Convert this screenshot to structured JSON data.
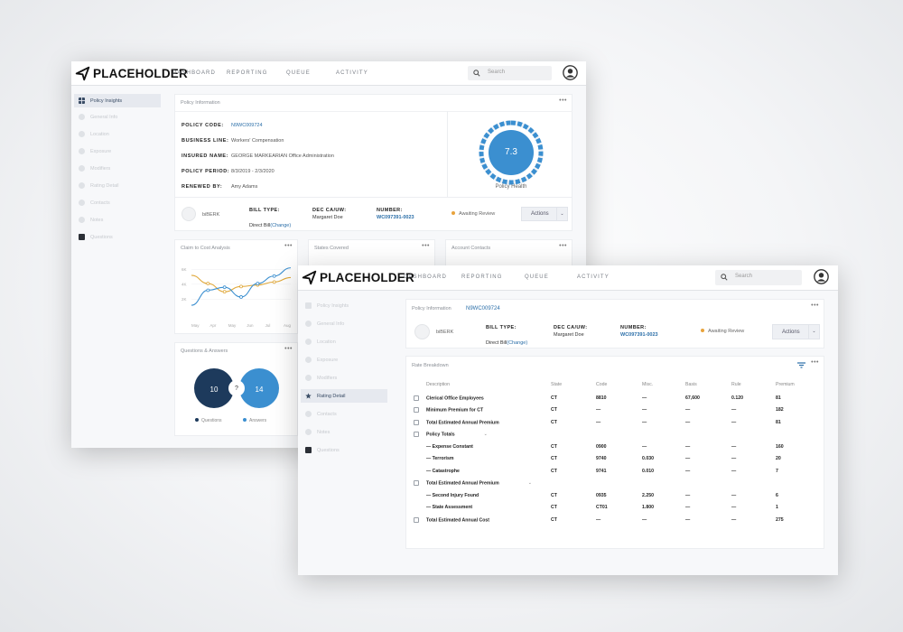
{
  "colors": {
    "accent": "#2a6ea8",
    "gauge": "#3b8fd0",
    "warning": "#e8a33c",
    "navy": "#1d3a5c",
    "line_blue": "#3b8fd0",
    "line_orange": "#e0a83a"
  },
  "back_window": {
    "logo": "PLACEHOLDER",
    "nav": [
      "DASHBOARD",
      "REPORTING",
      "QUEUE",
      "ACTIVITY"
    ],
    "search_placeholder": "Search",
    "sidebar": [
      "Policy Insights",
      "General Info",
      "Location",
      "Exposure",
      "Modifiers",
      "Rating Detail",
      "Contacts",
      "Notes",
      "Questions"
    ],
    "policy_card": {
      "title": "Policy Information",
      "fields": [
        {
          "label": "POLICY CODE:",
          "value": "N9WC009724"
        },
        {
          "label": "BUSINESS LINE:",
          "value": "Workers' Compensation"
        },
        {
          "label": "INSURED NAME:",
          "value": "GEORGE MARKEARIAN Office Administration"
        },
        {
          "label": "POLICY PERIOD:",
          "value": "8/3/2019 - 2/3/2020"
        },
        {
          "label": "RENEWED BY:",
          "value": "Amy Adams"
        }
      ],
      "health_value": "7.3",
      "health_label": "Policy Health",
      "health_fraction": 0.73,
      "company": "biBERK",
      "bill_type_label": "BILL TYPE:",
      "bill_type_value": "Direct Bill",
      "bill_change": "(Change)",
      "dec_label": "DEC CA/UW:",
      "dec_value": "Margaret Doe",
      "number_label": "NUMBER:",
      "number_value": "WC097391-0023",
      "status": "Awaiting Review",
      "actions": "Actions"
    },
    "claim_card": {
      "title": "Claim to Cost Analysis",
      "y_ticks": [
        "6K",
        "4K",
        "2K"
      ],
      "x_ticks": [
        "May",
        "Apr",
        "May",
        "Jun",
        "Jul",
        "Aug"
      ]
    },
    "states_card": {
      "title": "States Covered"
    },
    "contacts_card": {
      "title": "Account Contacts"
    },
    "qa_card": {
      "title": "Questions & Answers",
      "questions_count": "10",
      "answers_count": "14",
      "mid": "?",
      "legend_questions": "Questions",
      "legend_answers": "Answers"
    }
  },
  "chart_data": {
    "type": "line",
    "categories": [
      "May",
      "Apr",
      "May",
      "Jun",
      "Jul",
      "Aug"
    ],
    "ylim": [
      0,
      7000
    ],
    "y_ticks": [
      "6K",
      "4K",
      "2K"
    ],
    "series": [
      {
        "values": [
          5200,
          4100,
          3000,
          3700,
          3900,
          4300,
          4900
        ]
      },
      {
        "values": [
          1200,
          3200,
          3600,
          2300,
          4100,
          5100,
          6200
        ]
      }
    ]
  },
  "front_window": {
    "logo": "PLACEHOLDER",
    "nav": [
      "DASHBOARD",
      "REPORTING",
      "QUEUE",
      "ACTIVITY"
    ],
    "search_placeholder": "Search",
    "sidebar": [
      "Policy Insights",
      "General Info",
      "Location",
      "Exposure",
      "Modifiers",
      "Rating Detail",
      "Contacts",
      "Notes",
      "Questions"
    ],
    "policy_info_label": "Policy Information",
    "policy_code": "N9WC009724",
    "company": "biBERK",
    "bill_type_label": "BILL TYPE:",
    "bill_type_value": "Direct Bill",
    "bill_change": "(Change)",
    "dec_label": "DEC CA/UW:",
    "dec_value": "Margaret Doe",
    "number_label": "NUMBER:",
    "number_value": "WC097391-0023",
    "status": "Awaiting Review",
    "actions": "Actions",
    "rate_title": "Rate Breakdown",
    "columns": [
      "Description",
      "State",
      "Code",
      "Misc.",
      "Basis",
      "Rule",
      "Premium"
    ],
    "rows": [
      {
        "desc": "Clerical Office Employees",
        "check": true,
        "state": "CT",
        "code": "8810",
        "misc": "—",
        "basis": "67,600",
        "rule": "0.120",
        "premium": "81"
      },
      {
        "desc": "Minimum Premium for CT",
        "check": true,
        "state": "CT",
        "code": "—",
        "misc": "—",
        "basis": "—",
        "rule": "—",
        "premium": "182"
      },
      {
        "desc": "Total Estimated Annual Premium",
        "check": true,
        "state": "CT",
        "code": "—",
        "misc": "—",
        "basis": "—",
        "rule": "—",
        "premium": "81"
      },
      {
        "desc": "Policy Totals",
        "check": true,
        "expand": true,
        "state": "",
        "code": "",
        "misc": "",
        "basis": "",
        "rule": "",
        "premium": ""
      },
      {
        "desc": "— Expense Constant",
        "check": false,
        "state": "CT",
        "code": "0900",
        "misc": "—",
        "basis": "—",
        "rule": "—",
        "premium": "160"
      },
      {
        "desc": "— Terrorism",
        "check": false,
        "state": "CT",
        "code": "9740",
        "misc": "0.030",
        "basis": "—",
        "rule": "—",
        "premium": "20"
      },
      {
        "desc": "— Catastrophe",
        "check": false,
        "state": "CT",
        "code": "9741",
        "misc": "0.010",
        "basis": "—",
        "rule": "—",
        "premium": "7"
      },
      {
        "desc": "Total Estimated Annual Premium",
        "check": true,
        "expand": true,
        "state": "",
        "code": "",
        "misc": "",
        "basis": "",
        "rule": "",
        "premium": ""
      },
      {
        "desc": "— Second Injury Found",
        "check": false,
        "state": "CT",
        "code": "0935",
        "misc": "2.250",
        "basis": "—",
        "rule": "—",
        "premium": "6"
      },
      {
        "desc": "— State Assessment",
        "check": false,
        "state": "CT",
        "code": "CT01",
        "misc": "1.800",
        "basis": "—",
        "rule": "—",
        "premium": "1"
      },
      {
        "desc": "Total Estimated Annual Cost",
        "check": true,
        "state": "CT",
        "code": "—",
        "misc": "—",
        "basis": "—",
        "rule": "—",
        "premium": "275"
      }
    ]
  }
}
